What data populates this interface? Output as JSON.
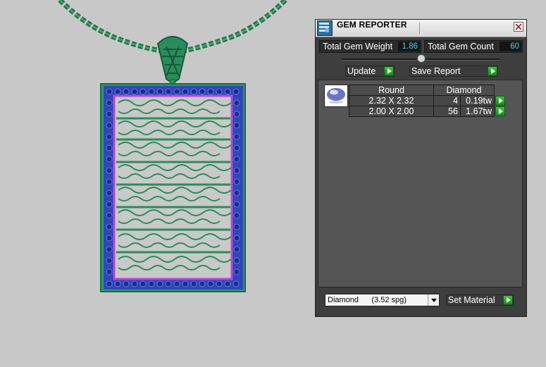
{
  "window": {
    "title": "GEM REPORTER",
    "close_icon": "close-icon",
    "app_icon": "gem-reporter-app-icon"
  },
  "stats": {
    "total_weight_label": "Total Gem Weight",
    "total_weight_value": "1.86",
    "total_count_label": "Total Gem Count",
    "total_count_value": "60"
  },
  "actions": {
    "update_label": "Update",
    "save_report_label": "Save Report"
  },
  "gem_table": {
    "header": {
      "shape": "Round",
      "material": "Diamond"
    },
    "rows": [
      {
        "size": "2.32 X 2.32",
        "count": "4",
        "weight": "0.19tw"
      },
      {
        "size": "2.00 X 2.00",
        "count": "56",
        "weight": "1.67tw"
      }
    ]
  },
  "material": {
    "selected": "Diamond      (3.52 spg)",
    "set_material_label": "Set Material"
  },
  "colors": {
    "accent_value": "#4fd2f5",
    "go_button": "#2aa52a",
    "pendant_green": "#2e8b5c",
    "gem_blue": "#2e3ea8",
    "panel_bg": "#3e3e3e"
  }
}
